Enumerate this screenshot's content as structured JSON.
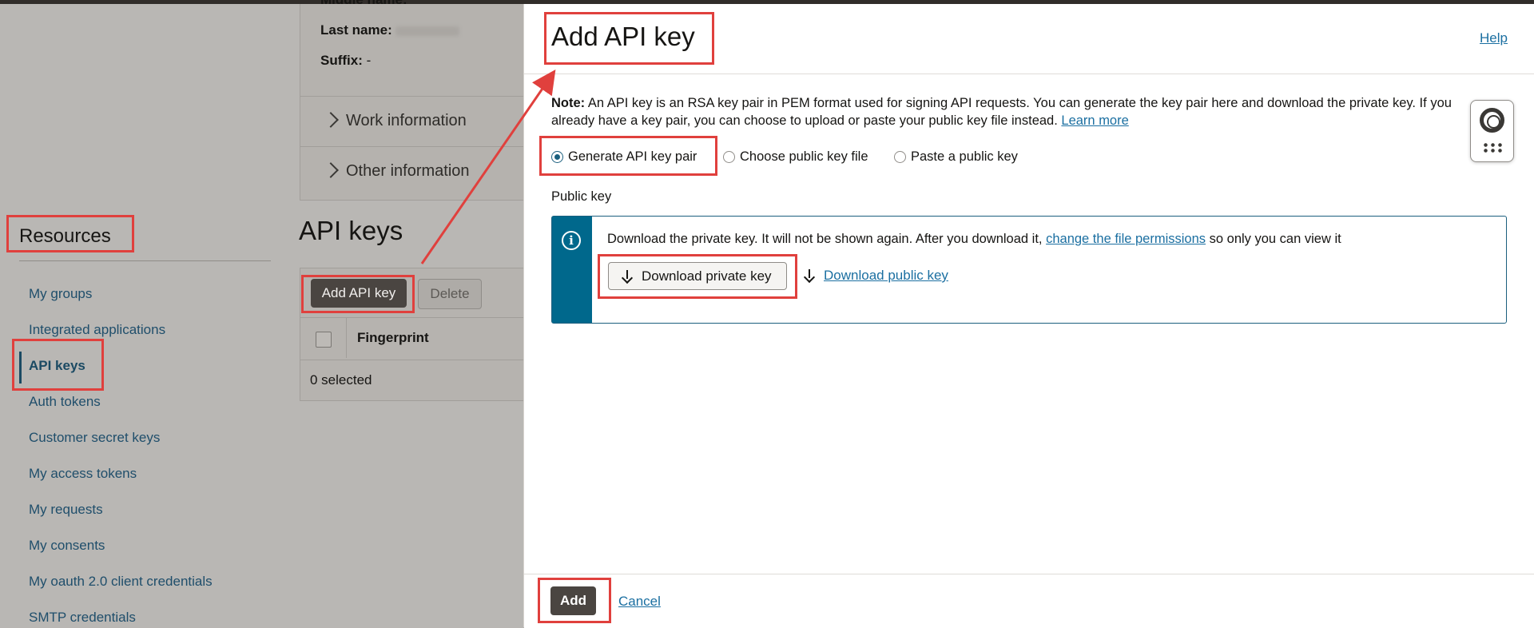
{
  "profile": {
    "middle_name_label": "Middle name:",
    "last_name_label": "Last name:",
    "suffix_label": "Suffix:",
    "suffix_value": "-",
    "sections": [
      "Work information",
      "Other information"
    ]
  },
  "resources": {
    "title": "Resources",
    "items": [
      {
        "label": "My groups"
      },
      {
        "label": "Integrated applications"
      },
      {
        "label": "API keys",
        "active": true
      },
      {
        "label": "Auth tokens"
      },
      {
        "label": "Customer secret keys"
      },
      {
        "label": "My access tokens"
      },
      {
        "label": "My requests"
      },
      {
        "label": "My consents"
      },
      {
        "label": "My oauth 2.0 client credentials"
      },
      {
        "label": "SMTP credentials"
      }
    ]
  },
  "api_keys": {
    "title": "API keys",
    "add_button": "Add API key",
    "delete_button": "Delete",
    "column_fingerprint": "Fingerprint",
    "selected_text": "0 selected"
  },
  "drawer": {
    "title": "Add API key",
    "help_link": "Help",
    "note_label": "Note:",
    "note_text": " An API key is an RSA key pair in PEM format used for signing API requests. You can generate the key pair here and download the private key. If you already have a key pair, you can choose to upload or paste your public key file instead. ",
    "learn_more": "Learn more",
    "options": [
      {
        "label": "Generate API key pair",
        "selected": true
      },
      {
        "label": "Choose public key file",
        "selected": false
      },
      {
        "label": "Paste a public key",
        "selected": false
      }
    ],
    "public_key_label": "Public key",
    "info_text_1": "Download the private key. It will not be shown again. After you download it, ",
    "info_link": "change the file permissions",
    "info_text_2": " so only you can view it",
    "download_private": "Download private key",
    "download_public": "Download public key",
    "add_button": "Add",
    "cancel_link": "Cancel"
  },
  "colors": {
    "annotation": "#e0403d",
    "accent": "#00688c",
    "link": "#1b6fa1"
  }
}
